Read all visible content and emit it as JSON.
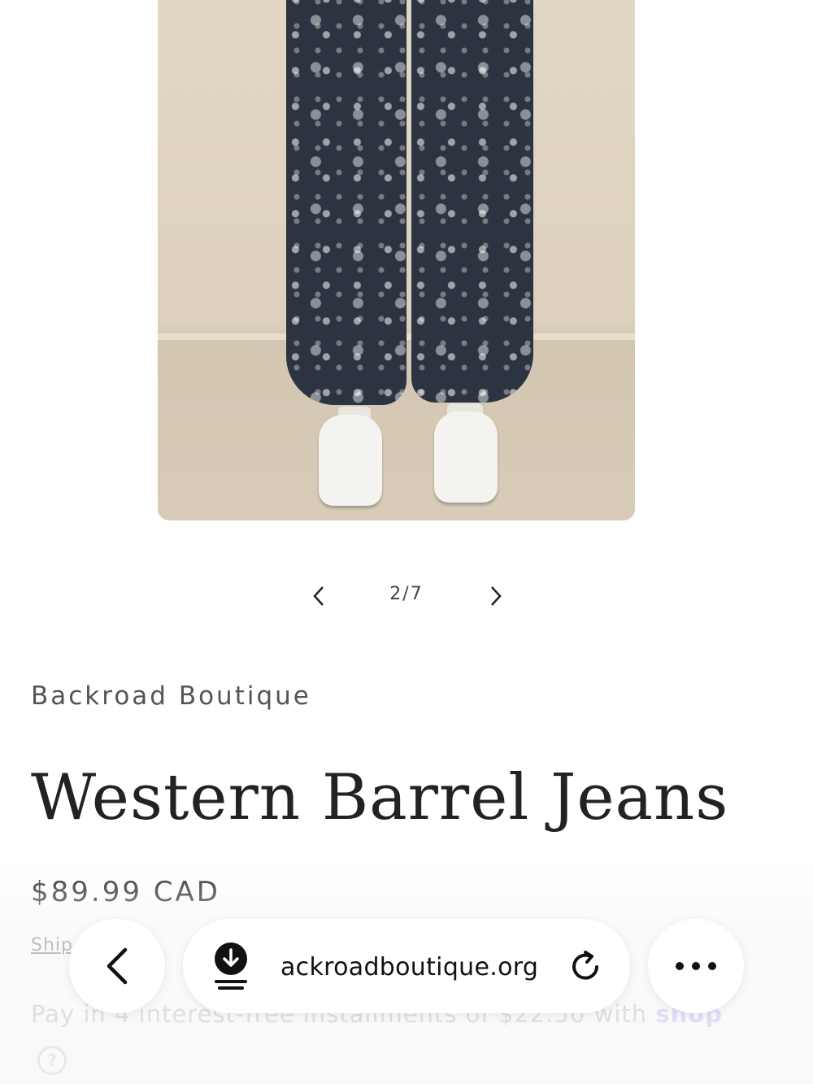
{
  "gallery": {
    "counter": "2/7",
    "prev_icon": "chevron-left-icon",
    "next_icon": "chevron-right-icon"
  },
  "product": {
    "vendor": "Backroad Boutique",
    "title": "Western Barrel Jeans",
    "price": "$89.99 CAD",
    "shipping_link": "Ship",
    "installments_text": "Pay in 4 interest-free installments of $22.50 with",
    "shop_brand": "shop"
  },
  "browser": {
    "url": "ackroadboutique.org",
    "back_icon": "chevron-left-icon",
    "download_icon": "download-icon",
    "reload_icon": "reload-icon",
    "more_icon": "more-icon"
  },
  "colors": {
    "accent": "#b9b2ff",
    "text": "#222222"
  }
}
